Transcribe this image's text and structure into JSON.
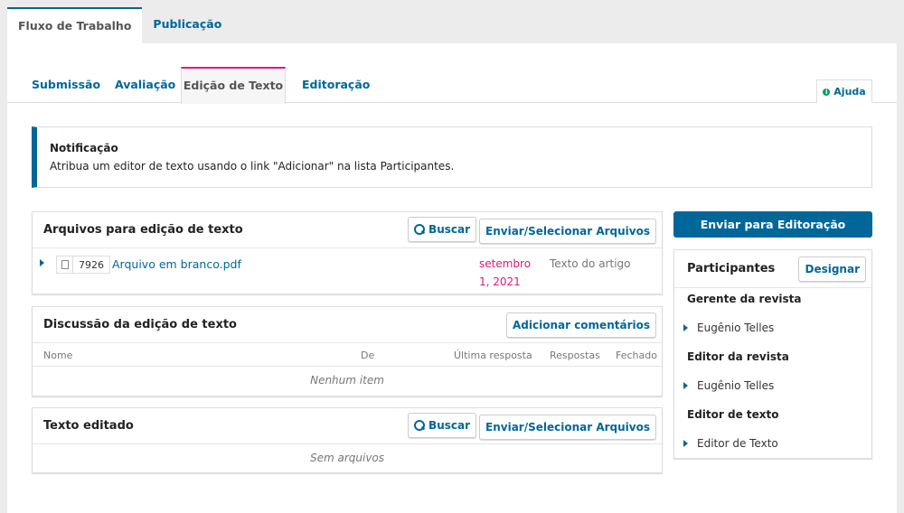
{
  "top_tabs": [
    {
      "label": "Fluxo de Trabalho",
      "active": true
    },
    {
      "label": "Publicação",
      "active": false
    }
  ],
  "sub_tabs": [
    {
      "label": "Submissão"
    },
    {
      "label": "Avaliação"
    },
    {
      "label": "Edição de Texto",
      "active": true
    },
    {
      "label": "Editoração"
    }
  ],
  "help_label": "Ajuda",
  "notification": {
    "title": "Notificação",
    "text": "Atribua um editor de texto usando o link \"Adicionar\" na lista Participantes."
  },
  "copyediting_files": {
    "title": "Arquivos para edição de texto",
    "search_label": "Buscar",
    "upload_label": "Enviar/Selecionar Arquivos",
    "file": {
      "id": "7926",
      "name": "Arquivo em branco.pdf",
      "date_line1": "setembro",
      "date_line2": "1, 2021",
      "type": "Texto do artigo"
    }
  },
  "discussion": {
    "title": "Discussão da edição de texto",
    "add_label": "Adicionar comentários",
    "columns": [
      "Nome",
      "De",
      "Última resposta",
      "Respostas",
      "Fechado"
    ],
    "empty": "Nenhum item"
  },
  "edited": {
    "title": "Texto editado",
    "search_label": "Buscar",
    "upload_label": "Enviar/Selecionar Arquivos",
    "empty": "Sem arquivos"
  },
  "send_label": "Enviar para Editoração",
  "participants": {
    "title": "Participantes",
    "assign_label": "Designar",
    "groups": [
      {
        "title": "Gerente da revista",
        "person": "Eugênio Telles"
      },
      {
        "title": "Editor da revista",
        "person": "Eugênio Telles"
      },
      {
        "title": "Editor de texto",
        "person": "Editor de Texto"
      }
    ]
  },
  "colors": {
    "accent": "#006798",
    "active_tab": "#e0187a",
    "date": "#e0187a"
  }
}
